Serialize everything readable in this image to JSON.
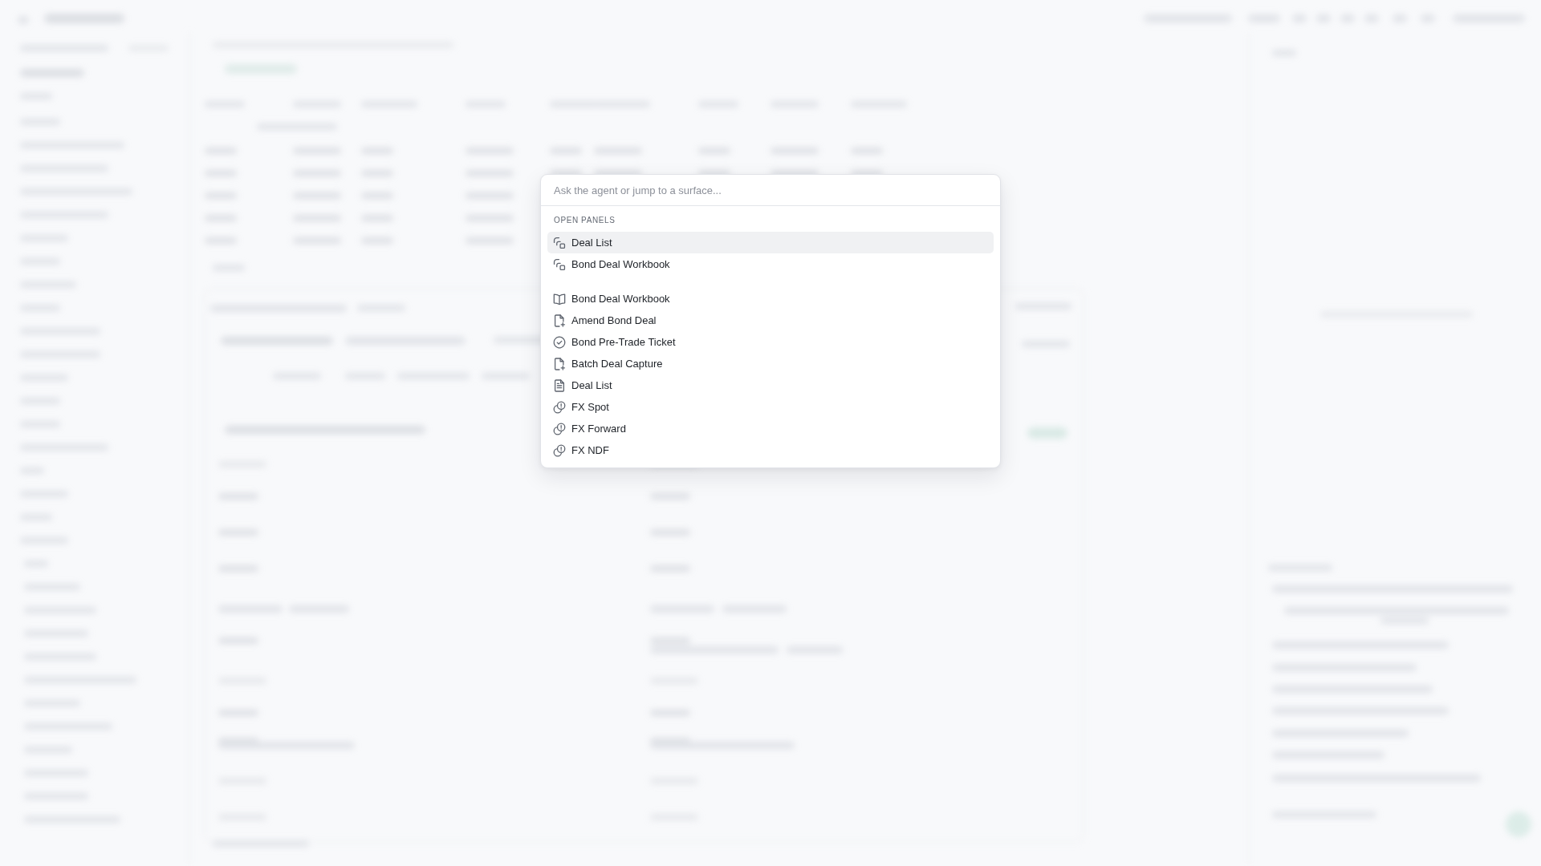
{
  "command_palette": {
    "search": {
      "placeholder": "Ask the agent or jump to a surface..."
    },
    "sections": [
      {
        "heading": "OPEN PANELS",
        "items": [
          {
            "label": "Deal List",
            "kind": "panel",
            "selected": true
          },
          {
            "label": "Bond Deal Workbook",
            "kind": "panel",
            "selected": false
          }
        ]
      },
      {
        "items": [
          {
            "label": "Bond Deal Workbook",
            "kind": "workbook",
            "selected": false
          },
          {
            "label": "Amend Bond Deal",
            "kind": "capture",
            "selected": false
          },
          {
            "label": "Bond Pre-Trade Ticket",
            "kind": "ticket",
            "selected": false
          },
          {
            "label": "Batch Deal Capture",
            "kind": "capture",
            "selected": false
          },
          {
            "label": "Deal List",
            "kind": "list",
            "selected": false
          },
          {
            "label": "FX Spot",
            "kind": "fx",
            "selected": false
          },
          {
            "label": "FX Forward",
            "kind": "fx",
            "selected": false
          },
          {
            "label": "FX NDF",
            "kind": "fx",
            "selected": false
          }
        ]
      }
    ]
  }
}
